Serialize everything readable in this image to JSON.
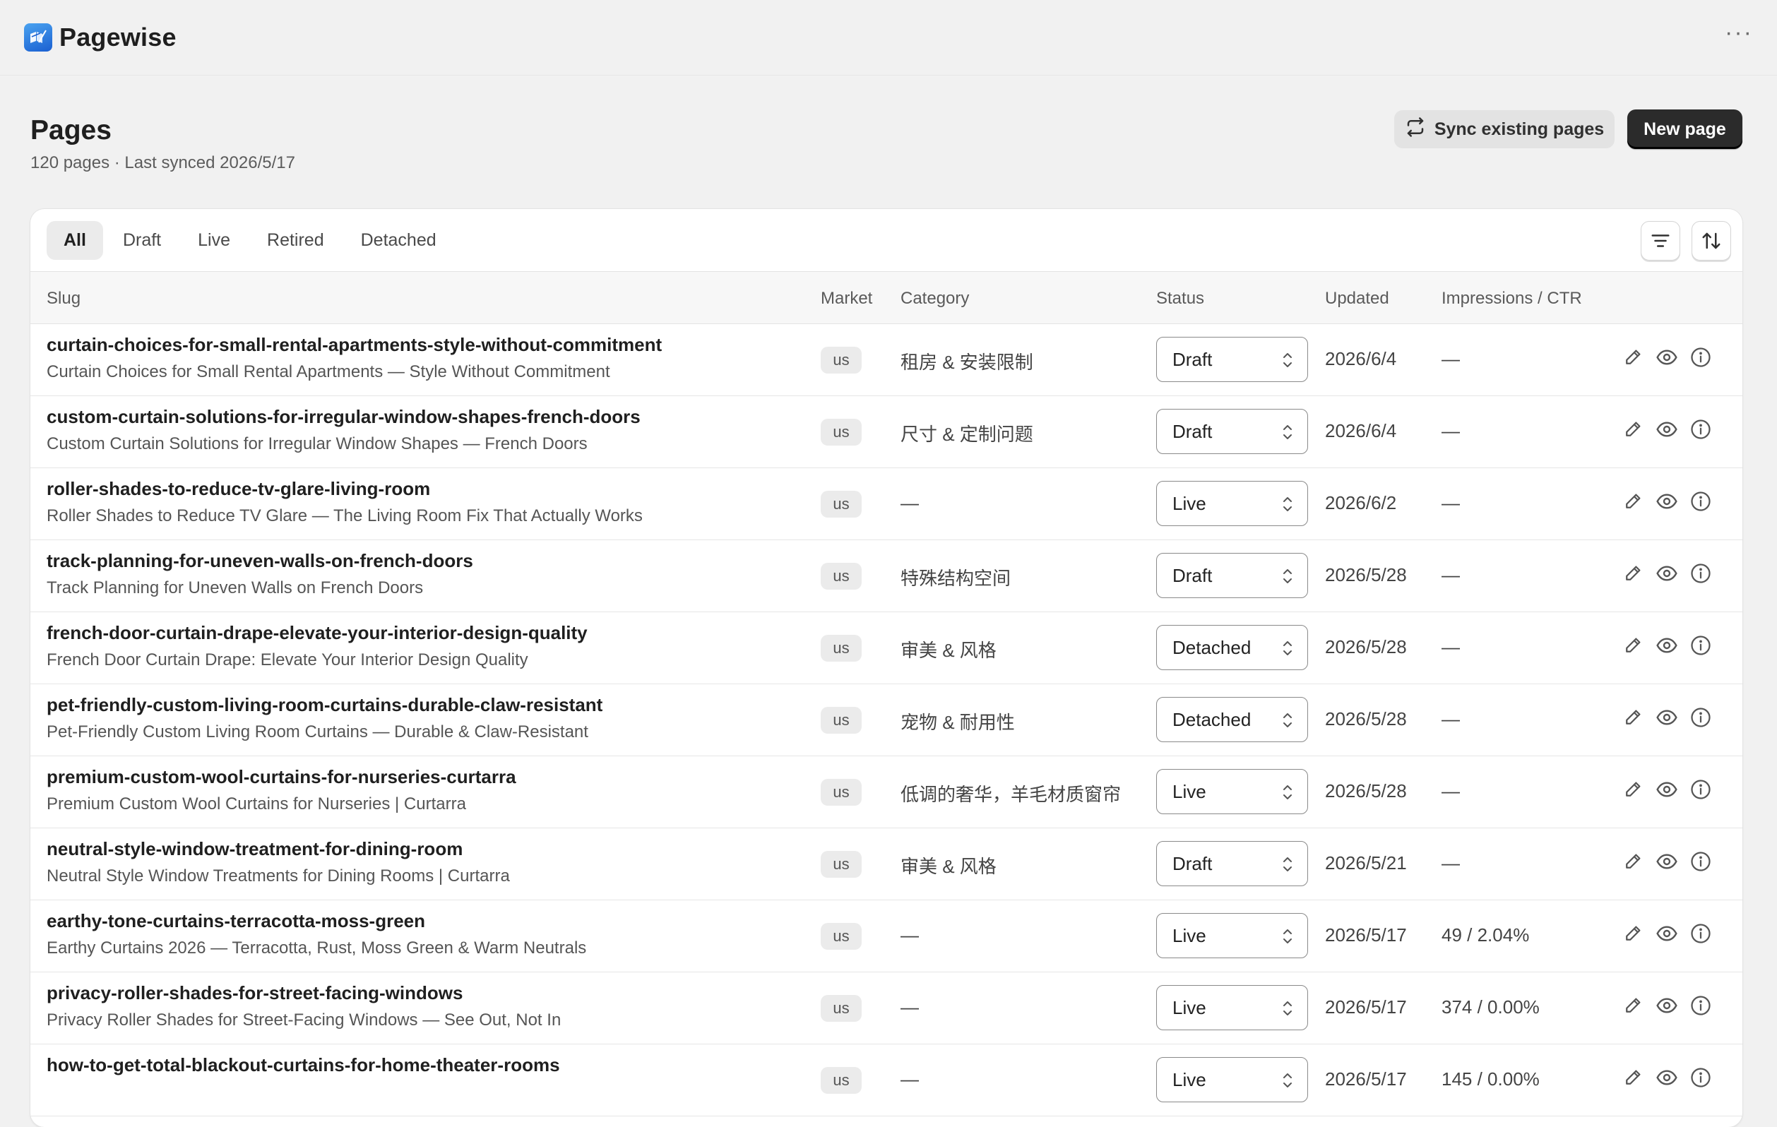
{
  "app": {
    "name": "Pagewise",
    "more_icon": "more-horizontal-icon"
  },
  "header": {
    "title": "Pages",
    "subtitle": "120 pages · Last synced 2026/5/17",
    "sync_label": "Sync existing pages",
    "new_label": "New page"
  },
  "tabs": [
    "All",
    "Draft",
    "Live",
    "Retired",
    "Detached"
  ],
  "active_tab": "All",
  "columns": {
    "slug": "Slug",
    "market": "Market",
    "category": "Category",
    "status": "Status",
    "updated": "Updated",
    "impressions": "Impressions / CTR"
  },
  "rows": [
    {
      "slug": "curtain-choices-for-small-rental-apartments-style-without-commitment",
      "title": "Curtain Choices for Small Rental Apartments — Style Without Commitment",
      "market": "us",
      "category": "租房 & 安装限制",
      "status": "Draft",
      "updated": "2026/6/4",
      "impressions": "—"
    },
    {
      "slug": "custom-curtain-solutions-for-irregular-window-shapes-french-doors",
      "title": "Custom Curtain Solutions for Irregular Window Shapes — French Doors",
      "market": "us",
      "category": "尺寸 & 定制问题",
      "status": "Draft",
      "updated": "2026/6/4",
      "impressions": "—"
    },
    {
      "slug": "roller-shades-to-reduce-tv-glare-living-room",
      "title": "Roller Shades to Reduce TV Glare — The Living Room Fix That Actually Works",
      "market": "us",
      "category": "—",
      "status": "Live",
      "updated": "2026/6/2",
      "impressions": "—"
    },
    {
      "slug": "track-planning-for-uneven-walls-on-french-doors",
      "title": "Track Planning for Uneven Walls on French Doors",
      "market": "us",
      "category": "特殊结构空间",
      "status": "Draft",
      "updated": "2026/5/28",
      "impressions": "—"
    },
    {
      "slug": "french-door-curtain-drape-elevate-your-interior-design-quality",
      "title": "French Door Curtain Drape: Elevate Your Interior Design Quality",
      "market": "us",
      "category": "审美 & 风格",
      "status": "Detached",
      "updated": "2026/5/28",
      "impressions": "—"
    },
    {
      "slug": "pet-friendly-custom-living-room-curtains-durable-claw-resistant",
      "title": "Pet-Friendly Custom Living Room Curtains — Durable & Claw-Resistant",
      "market": "us",
      "category": "宠物 & 耐用性",
      "status": "Detached",
      "updated": "2026/5/28",
      "impressions": "—"
    },
    {
      "slug": "premium-custom-wool-curtains-for-nurseries-curtarra",
      "title": "Premium Custom Wool Curtains for Nurseries | Curtarra",
      "market": "us",
      "category": "低调的奢华，羊毛材质窗帘",
      "status": "Live",
      "updated": "2026/5/28",
      "impressions": "—"
    },
    {
      "slug": "neutral-style-window-treatment-for-dining-room",
      "title": "Neutral Style Window Treatments for Dining Rooms | Curtarra",
      "market": "us",
      "category": "审美 & 风格",
      "status": "Draft",
      "updated": "2026/5/21",
      "impressions": "—"
    },
    {
      "slug": "earthy-tone-curtains-terracotta-moss-green",
      "title": "Earthy Curtains 2026 — Terracotta, Rust, Moss Green & Warm Neutrals",
      "market": "us",
      "category": "—",
      "status": "Live",
      "updated": "2026/5/17",
      "impressions": "49 / 2.04%"
    },
    {
      "slug": "privacy-roller-shades-for-street-facing-windows",
      "title": "Privacy Roller Shades for Street-Facing Windows — See Out, Not In",
      "market": "us",
      "category": "—",
      "status": "Live",
      "updated": "2026/5/17",
      "impressions": "374 / 0.00%"
    },
    {
      "slug": "how-to-get-total-blackout-curtains-for-home-theater-rooms",
      "title": "",
      "market": "us",
      "category": "—",
      "status": "Live",
      "updated": "2026/5/17",
      "impressions": "145 / 0.00%"
    }
  ],
  "row_actions": [
    "edit-icon",
    "preview-eye-icon",
    "info-icon"
  ],
  "colors": {
    "primary_button": "#2b2b2b",
    "background": "#f1f1f1",
    "card": "#ffffff"
  }
}
